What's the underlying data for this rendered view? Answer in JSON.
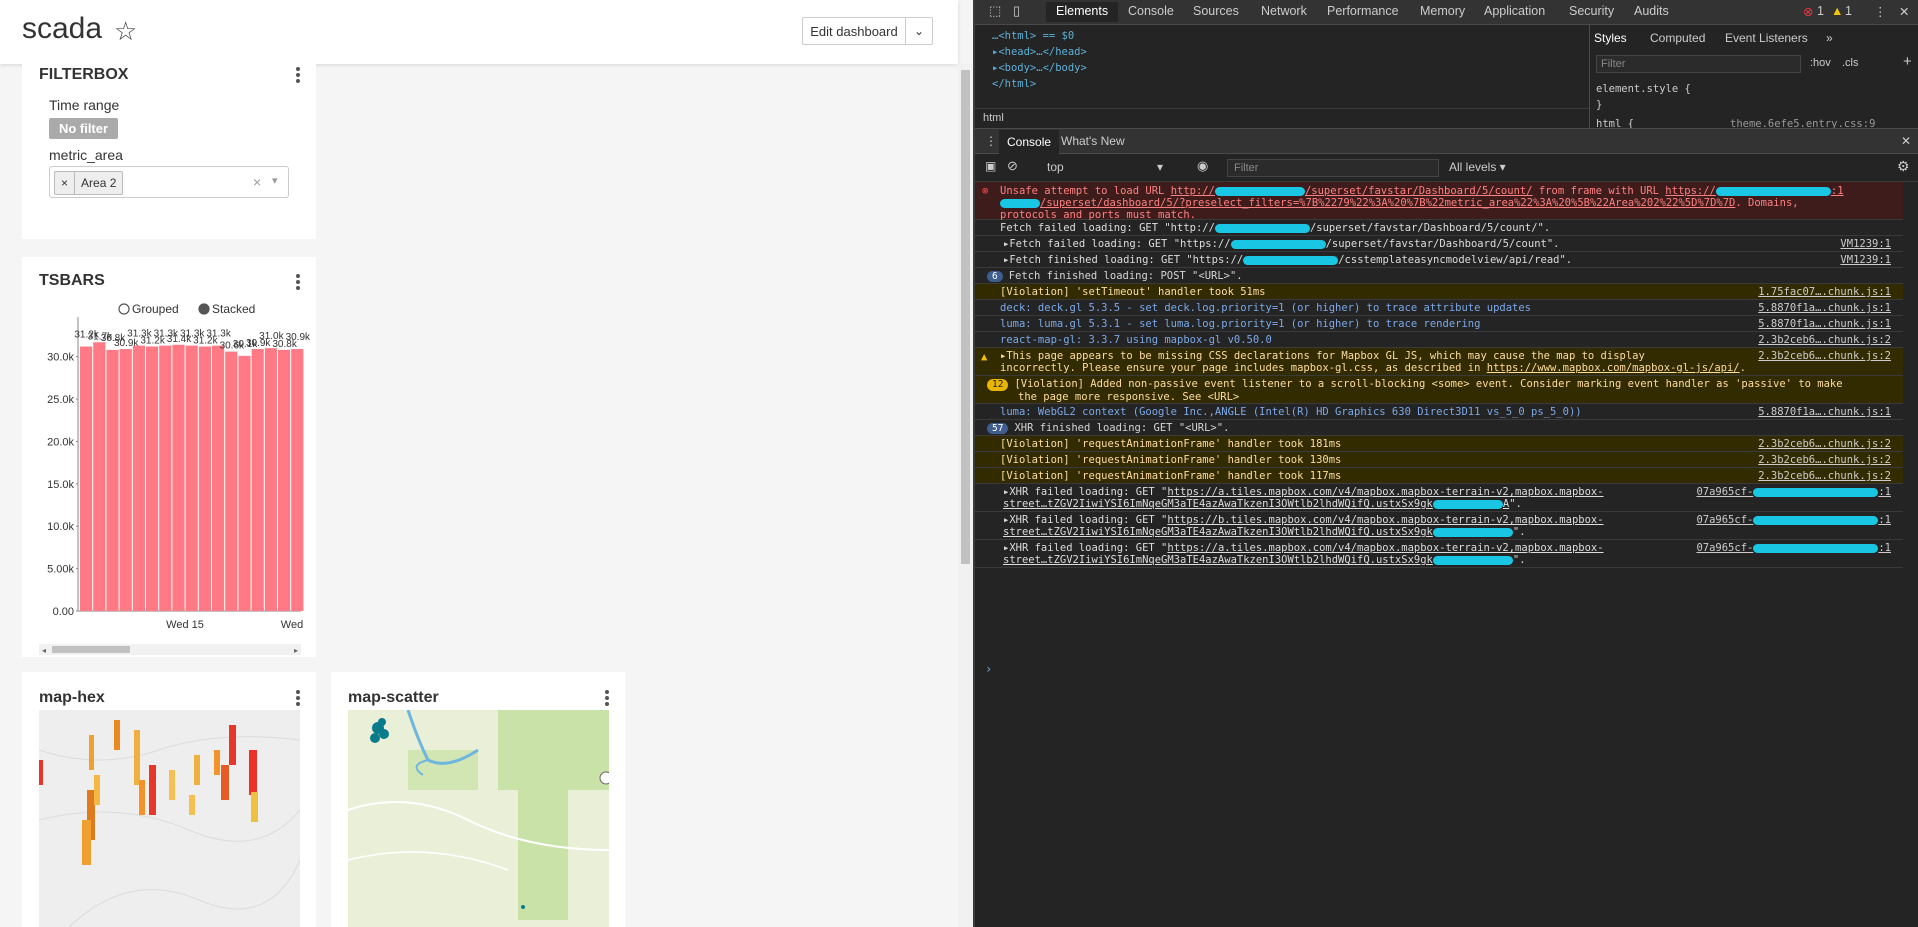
{
  "dashboard": {
    "title": "scada",
    "edit_label": "Edit dashboard",
    "filterbox": {
      "title": "FILTERBOX",
      "time_label": "Time range",
      "no_filter": "No filter",
      "metric_label": "metric_area",
      "selected_tag": "Area 2",
      "tag_remove": "×",
      "clear": "×",
      "arrow": "▾"
    },
    "tsbars": {
      "title": "TSBARS"
    },
    "map_hex": {
      "title": "map-hex"
    },
    "map_scatter": {
      "title": "map-scatter"
    }
  },
  "chart_data": {
    "type": "bar",
    "legend": [
      "Grouped",
      "Stacked"
    ],
    "legend_selected": "Stacked",
    "legend_position": "top",
    "ytick_labels": [
      "0.00",
      "5.00k",
      "10.0k",
      "15.0k",
      "20.0k",
      "25.0k",
      "30.0k"
    ],
    "xtick_labels": [
      "Wed 15",
      "Wed"
    ],
    "ylim": [
      0,
      33500
    ],
    "values": [
      31200,
      31700,
      30800,
      30900,
      31300,
      31200,
      31300,
      31400,
      31300,
      31200,
      31300,
      30600,
      30100,
      30900,
      31000,
      30800,
      30900
    ],
    "value_labels": [
      "31.2k",
      "31.7k",
      "30.8k",
      "30.9k",
      "31.3k",
      "31.2k",
      "31.3k",
      "31.4k",
      "31.3k",
      "31.2k",
      "31.3k",
      "30.6k",
      "30.1k",
      "30.9k",
      "31.0k",
      "30.8k",
      "30.9k"
    ],
    "bar_color": "#ff7a85"
  },
  "devtools": {
    "tabs": [
      "Elements",
      "Console",
      "Sources",
      "Network",
      "Performance",
      "Memory",
      "Application",
      "Security",
      "Audits"
    ],
    "error_count": "1",
    "warn_count": "1",
    "tree": [
      "…<html> == $0",
      "▸<head>…</head>",
      "▸<body>…</body>",
      "</html>"
    ],
    "breadcrumb": "html",
    "styles_tabs": [
      "Styles",
      "Computed",
      "Event Listeners",
      "»"
    ],
    "styles_filter": "Filter",
    "hov": ":hov",
    "cls": ".cls",
    "plus": "+",
    "element_style": "element.style {",
    "element_style_close": "}",
    "html_rule": "html {",
    "theme_src": "theme.6efe5.entry.css:9",
    "drawer_tabs": [
      "Console",
      "What's New"
    ],
    "context": "top",
    "console_filter": "Filter",
    "levels": "All levels ▾",
    "messages": {
      "m1a": "Unsafe attempt to load URL ",
      "m1b": "http://",
      "m1c": "/superset/favstar/Dashboard/5/count/",
      "m1d": " from frame with URL ",
      "m1e": "https://",
      "m1f": ":1",
      "m1g": "/superset/dashboard/5/?preselect_filters=%7B%2279%22%3A%20%7B%22metric_area%22%3A%20%5B%22Area%202%22%5D%7D%7D",
      "m1h": ". Domains,",
      "m1i": "protocols and ports must match.",
      "m2a": "Fetch failed loading: GET \"http://",
      "m2b": "/superset/favstar/Dashboard/5/count/\".",
      "m3a": "Fetch failed loading: GET \"https://",
      "m3b": "/superset/favstar/Dashboard/5/count\".",
      "m3src": "VM1239:1",
      "m4a": "Fetch finished loading: GET \"https://",
      "m4b": "/csstemplateasyncmodelview/api/read\".",
      "m4src": "VM1239:1",
      "m5count": "6",
      "m5": "Fetch finished loading: POST \"<URL>\".",
      "m6": "[Violation] 'setTimeout' handler took 51ms",
      "m6src": "1.75fac07….chunk.js:1",
      "m7": "deck: deck.gl 5.3.5 - set deck.log.priority=1 (or higher) to trace attribute updates",
      "m7src": "5.8870f1a….chunk.js:1",
      "m8": "luma: luma.gl 5.3.1 - set luma.log.priority=1 (or higher) to trace rendering",
      "m8src": "5.8870f1a….chunk.js:1",
      "m9": "react-map-gl: 3.3.7 using mapbox-gl v0.50.0",
      "m9src": "2.3b2ceb6….chunk.js:2",
      "m10a": "This page appears to be missing CSS declarations for Mapbox GL JS, which may cause the map to display",
      "m10b": "incorrectly. Please ensure your page includes mapbox-gl.css, as described in ",
      "m10c": "https://www.mapbox.com/mapbox-gl-js/api/",
      "m10d": ".",
      "m10src": "2.3b2ceb6….chunk.js:2",
      "m11count": "12",
      "m11a": "[Violation] Added non-passive event listener to a scroll-blocking <some> event. Consider marking event handler as 'passive' to make",
      "m11b": "the page more responsive. See <URL>",
      "m12": "luma: WebGL2 context (Google Inc.,ANGLE (Intel(R) HD Graphics 630 Direct3D11 vs_5_0 ps_5_0))",
      "m12src": "5.8870f1a….chunk.js:1",
      "m13count": "57",
      "m13": "XHR finished loading: GET \"<URL>\".",
      "m14": "[Violation] 'requestAnimationFrame' handler took 181ms",
      "m15": "[Violation] 'requestAnimationFrame' handler took 130ms",
      "m16": "[Violation] 'requestAnimationFrame' handler took 117ms",
      "mrafsrc": "2.3b2ceb6….chunk.js:2",
      "x1a": "XHR failed loading: GET \"",
      "x1b": "https://a.tiles.mapbox.com/v4/mapbox.mapbox-terrain-v2,mapbox.mapbox-",
      "x1c": "street…tZGV2IiwiYSI6ImNqeGM3aTE4azAwaTkzenI3OWtlb2lhdWQifQ.ustxSx9gk",
      "x1d": "A",
      "x1e": "\".",
      "x2b": "https://b.tiles.mapbox.com/v4/mapbox.mapbox-terrain-v2,mapbox.mapbox-",
      "x3b": "https://a.tiles.mapbox.com/v4/mapbox.mapbox-terrain-v2,mapbox.mapbox-",
      "xsrc": "07a965cf-",
      "xsrcend": ":1"
    },
    "prompt": "›"
  }
}
